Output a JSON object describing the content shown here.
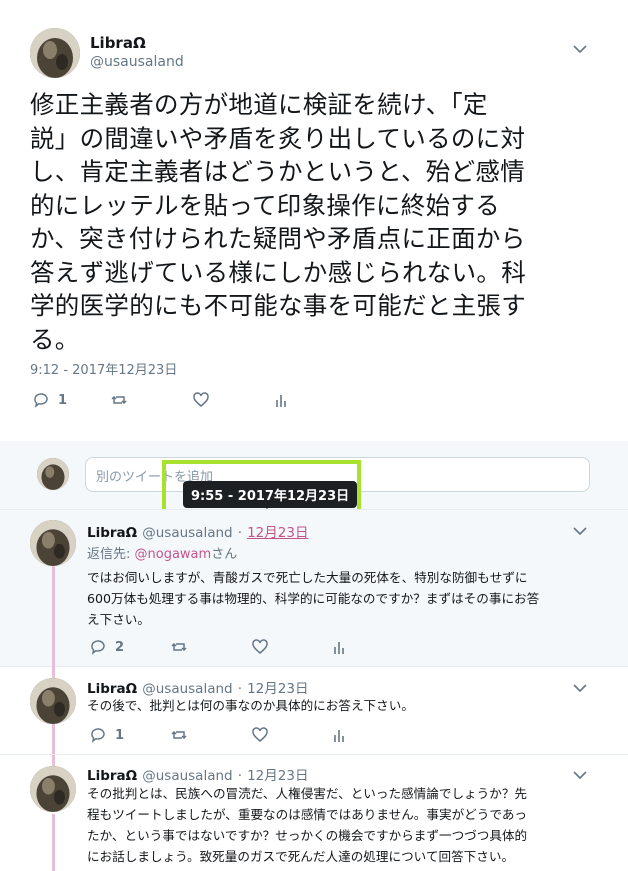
{
  "main_tweet": {
    "display_name": "LibraΩ",
    "handle": "@usausaland",
    "text_lines": [
      "修正主義者の方が地道に検証を続け、「定",
      "説」の間違いや矛盾を炙り出しているのに対",
      "し、肯定主義者はどうかというと、殆ど感情",
      "的にレッテルを貼って印象操作に終始する",
      "か、突き付けられた疑問や矛盾点に正面から",
      "答えず逃げている様にしか感じられない。科",
      "学的医学的にも不可能な事を可能だと主張す",
      "る。"
    ],
    "timestamp": "9:12 - 2017年12月23日",
    "reply_count": "1"
  },
  "compose": {
    "placeholder": "別のツイートを追加"
  },
  "tooltip": {
    "text": "9:55 - 2017年12月23日"
  },
  "colors": {
    "highlight": "#a6e22e",
    "thread_line": "#e8bdd6",
    "link": "#c0558e"
  },
  "replies": [
    {
      "display_name": "LibraΩ",
      "handle": "@usausaland",
      "date": "12月23日",
      "reply_to_prefix": "返信先: ",
      "reply_to_user": "@nogawam",
      "reply_to_suffix": "さん",
      "body_lines": [
        "ではお伺いしますが、青酸ガスで死亡した大量の死体を、特別な防御もせずに",
        "600万体も処理する事は物理的、科学的に可能なのですか？まずはその事にお答",
        "え下さい。"
      ],
      "reply_count": "2"
    },
    {
      "display_name": "LibraΩ",
      "handle": "@usausaland",
      "date": "12月23日",
      "body_lines": [
        "その後で、批判とは何の事なのか具体的にお答え下さい。"
      ],
      "reply_count": "1"
    },
    {
      "display_name": "LibraΩ",
      "handle": "@usausaland",
      "date": "12月23日",
      "body_lines": [
        "その批判とは、民族への冒涜だ、人権侵害だ、といった感情論でしょうか？先",
        "程もツイートしましたが、重要なのは感情ではありません。事実がどうであっ",
        "たか、という事ではないですか？せっかくの機会ですからまず一つづつ具体的",
        "にお話しましょう。致死量のガスで死んだ人達の処理について回答下さい。"
      ]
    }
  ],
  "icons": [
    "chevron-down-icon",
    "reply-icon",
    "retweet-icon",
    "like-icon",
    "analytics-icon"
  ]
}
